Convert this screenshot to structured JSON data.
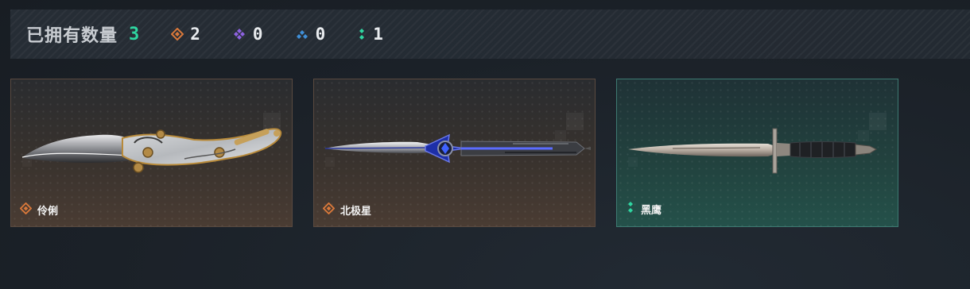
{
  "header": {
    "title": "已拥有数量",
    "total": "3",
    "stats": [
      {
        "icon": "orange-rarity-icon",
        "color": "#d9783a",
        "value": "2"
      },
      {
        "icon": "purple-rarity-icon",
        "color": "#8d62e0",
        "value": "0"
      },
      {
        "icon": "blue-rarity-icon",
        "color": "#3f8fd8",
        "value": "0"
      },
      {
        "icon": "green-rarity-icon",
        "color": "#2fd6a1",
        "value": "1"
      }
    ]
  },
  "cards": [
    {
      "name": "伶俐",
      "rarity": "orange",
      "weapon_icon": "karambit-knife-icon"
    },
    {
      "name": "北极星",
      "rarity": "orange",
      "weapon_icon": "polaris-stiletto-icon"
    },
    {
      "name": "黑鹰",
      "rarity": "green",
      "weapon_icon": "black-hawk-dagger-icon"
    }
  ],
  "colors": {
    "accent_green": "#2fd6a1",
    "orange": "#d9783a",
    "purple": "#8d62e0",
    "blue": "#3f8fd8"
  }
}
